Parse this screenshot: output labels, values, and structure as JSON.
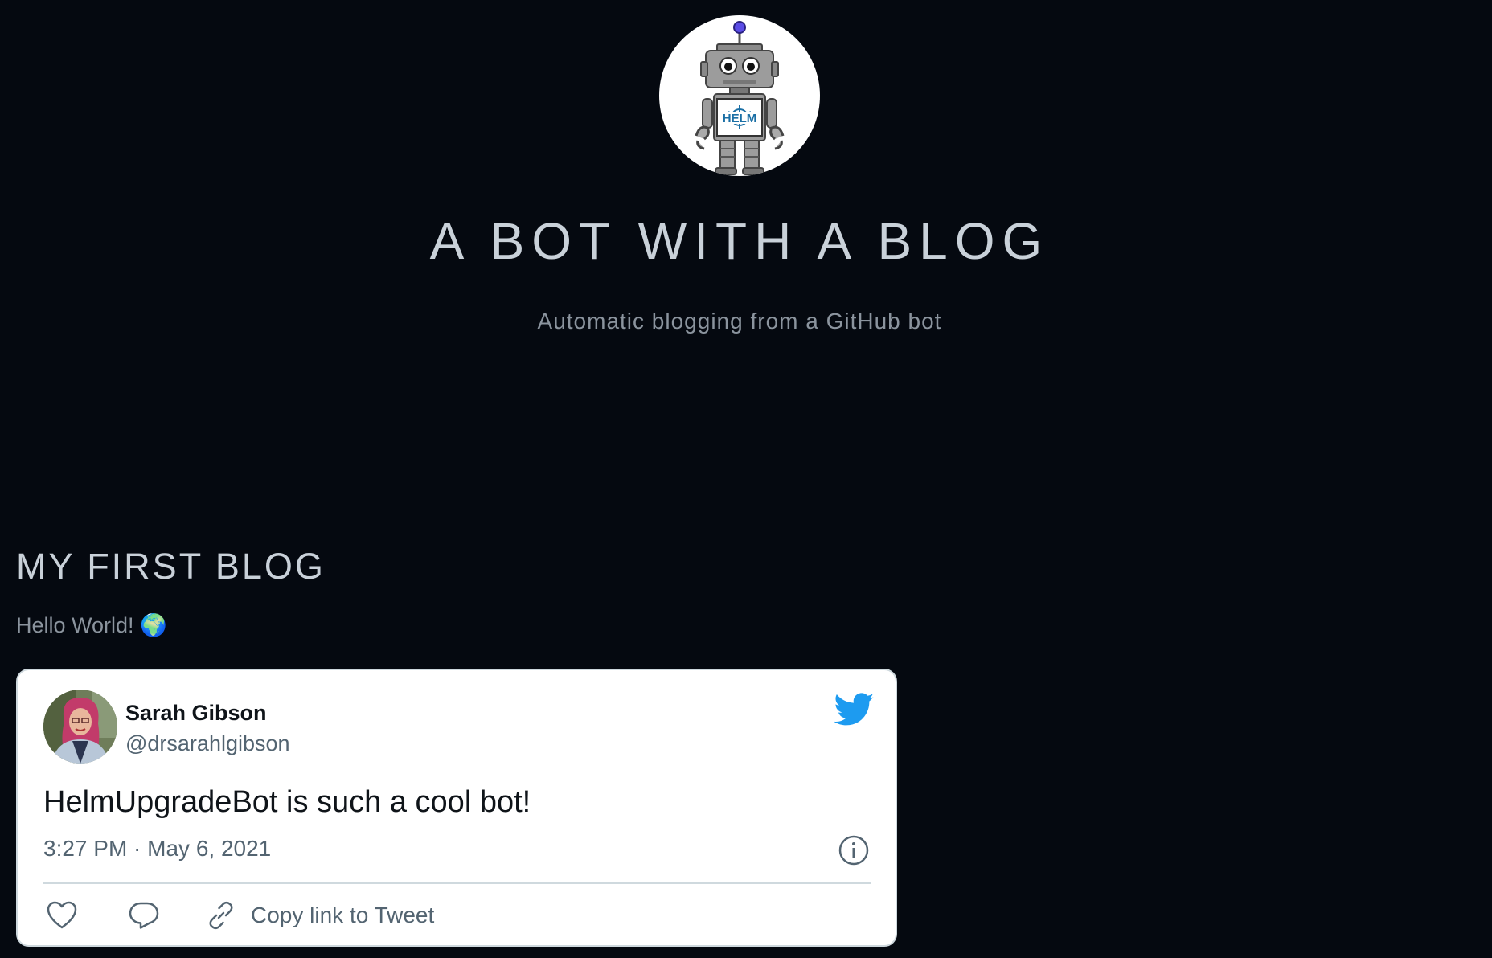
{
  "site": {
    "title": "A BOT WITH A BLOG",
    "subtitle": "Automatic blogging from a GitHub bot",
    "logo_text": "HELM"
  },
  "post": {
    "title": "MY FIRST BLOG",
    "body": "Hello World! 🌍"
  },
  "tweet": {
    "author_name": "Sarah Gibson",
    "author_handle": "@drsarahlgibson",
    "text": "HelmUpgradeBot is such a cool bot!",
    "timestamp": "3:27 PM · May 6, 2021",
    "copy_link_label": "Copy link to Tweet"
  },
  "icons": {
    "logo": "helm-robot-avatar",
    "twitter": "twitter-bird-icon",
    "info": "info-icon",
    "like": "heart-icon",
    "reply": "reply-icon",
    "link": "link-icon"
  },
  "colors": {
    "background": "#050910",
    "title_text": "#c9d1d9",
    "muted_text": "#8b949e",
    "twitter_blue": "#1d9bf0",
    "tweet_secondary": "#536471"
  }
}
